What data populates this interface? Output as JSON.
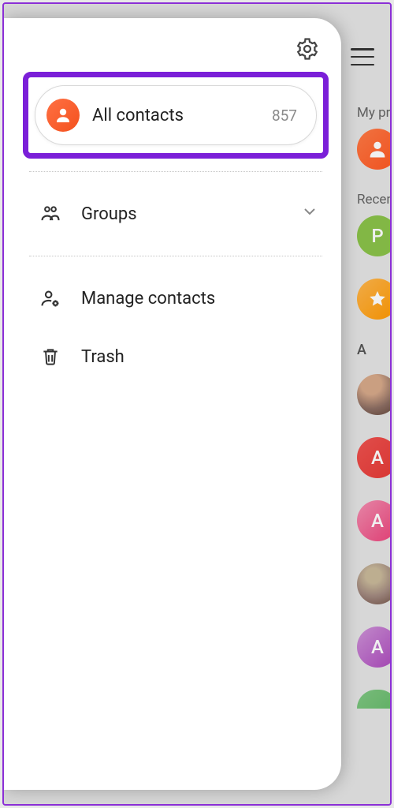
{
  "drawer": {
    "all_contacts_label": "All contacts",
    "all_contacts_count": "857",
    "groups_label": "Groups",
    "manage_label": "Manage contacts",
    "trash_label": "Trash"
  },
  "background": {
    "my_profile_label": "My profile",
    "recent_label": "Recently added",
    "section_a": "A",
    "avatars": {
      "p": "P",
      "a1": "A",
      "a2": "A",
      "a3": "A"
    }
  }
}
